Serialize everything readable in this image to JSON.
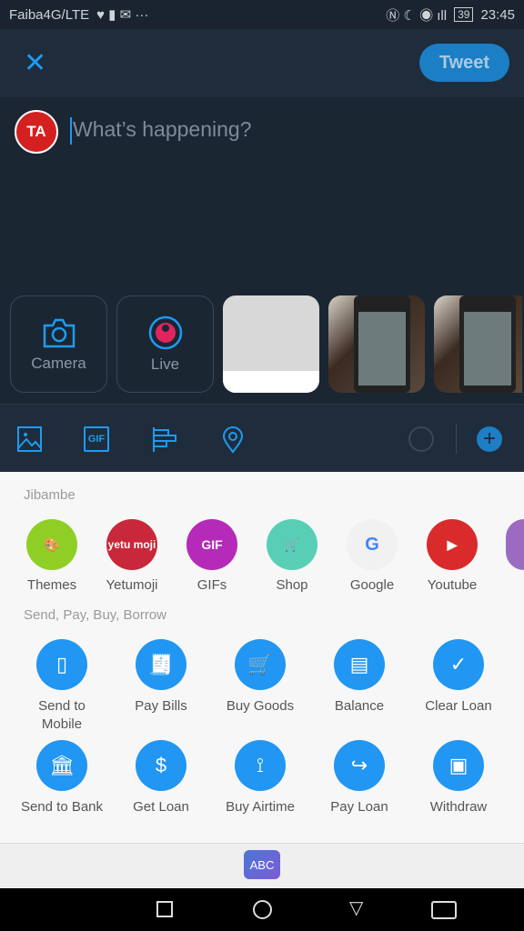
{
  "status": {
    "carrier": "Faiba4G/LTE",
    "battery": "39",
    "time": "23:45"
  },
  "header": {
    "tweet_label": "Tweet"
  },
  "compose": {
    "avatar_initials": "TA",
    "placeholder": "What’s happening?"
  },
  "media": {
    "camera_label": "Camera",
    "live_label": "Live"
  },
  "toolbar": {
    "icons": [
      "image-icon",
      "gif-icon",
      "poll-icon",
      "location-icon",
      "char-counter",
      "add-icon"
    ],
    "gif_text": "GIF"
  },
  "keyboard": {
    "section1": "Jibambe",
    "apps": [
      {
        "label": "Themes",
        "color": "#8fcf25"
      },
      {
        "label": "Yetumoji",
        "color": "#c8283a",
        "icon_text": "yetu moji"
      },
      {
        "label": "GIFs",
        "color": "#b52ab8",
        "icon_text": "GIF"
      },
      {
        "label": "Shop",
        "color": "#58cfb5"
      },
      {
        "label": "Google",
        "color": "#f1f1f1",
        "icon_text": "G"
      },
      {
        "label": "Youtube",
        "color": "#d92b2b"
      }
    ],
    "section2": "Send, Pay, Buy, Borrow",
    "pay": [
      {
        "label": "Send to Mobile",
        "icon": "phone-icon"
      },
      {
        "label": "Pay Bills",
        "icon": "bill-icon"
      },
      {
        "label": "Buy Goods",
        "icon": "cart-icon"
      },
      {
        "label": "Balance",
        "icon": "balance-icon"
      },
      {
        "label": "Clear Loan",
        "icon": "check-icon"
      },
      {
        "label": "Send to Bank",
        "icon": "bank-icon"
      },
      {
        "label": "Get Loan",
        "icon": "money-bag-icon"
      },
      {
        "label": "Buy Airtime",
        "icon": "tower-icon"
      },
      {
        "label": "Pay Loan",
        "icon": "share-icon"
      },
      {
        "label": "Withdraw",
        "icon": "atm-icon"
      }
    ],
    "abc_label": "ABC"
  }
}
